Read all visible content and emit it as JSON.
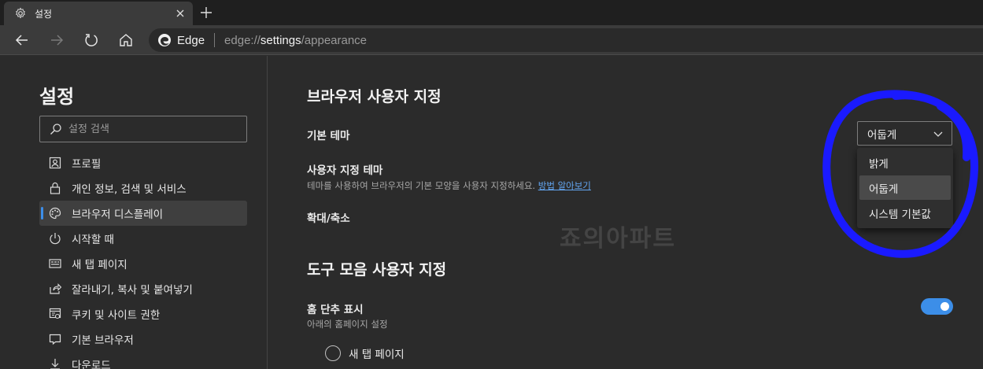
{
  "tab": {
    "title": "설정"
  },
  "address": {
    "site": "Edge",
    "url_prefix": "edge://",
    "url_host": "settings",
    "url_path": "/appearance"
  },
  "sidebar": {
    "title": "설정",
    "search_placeholder": "설정 검색",
    "items": [
      {
        "label": "프로필",
        "icon": "profile-icon"
      },
      {
        "label": "개인 정보, 검색 및 서비스",
        "icon": "lock-icon"
      },
      {
        "label": "브라우저 디스플레이",
        "icon": "palette-icon",
        "active": true
      },
      {
        "label": "시작할 때",
        "icon": "power-icon"
      },
      {
        "label": "새 탭 페이지",
        "icon": "new-tab-icon"
      },
      {
        "label": "잘라내기, 복사 및 붙여넣기",
        "icon": "share-icon"
      },
      {
        "label": "쿠키 및 사이트 권한",
        "icon": "cookie-icon"
      },
      {
        "label": "기본 브라우저",
        "icon": "browser-icon"
      },
      {
        "label": "다운로드",
        "icon": "download-icon"
      }
    ]
  },
  "main": {
    "section1_title": "브라우저 사용자 지정",
    "theme_label": "기본 테마",
    "theme_value": "어둡게",
    "theme_options": [
      "밝게",
      "어둡게",
      "시스템 기본값"
    ],
    "custom_theme_label": "사용자 지정 테마",
    "custom_theme_desc": "테마를 사용하여 브라우저의 기본 모양을 사용자 지정하세요.",
    "custom_theme_link": "방법 알아보기",
    "zoom_label": "확대/축소",
    "section2_title": "도구 모음 사용자 지정",
    "home_label": "홈 단추 표시",
    "home_desc": "아래의 홈페이지 설정",
    "home_toggle_on": true,
    "radio_new_tab": "새 탭 페이지"
  },
  "watermark": "죠의아파트",
  "colors": {
    "accent": "#3c8ee8",
    "annotation": "#1a1aff"
  }
}
